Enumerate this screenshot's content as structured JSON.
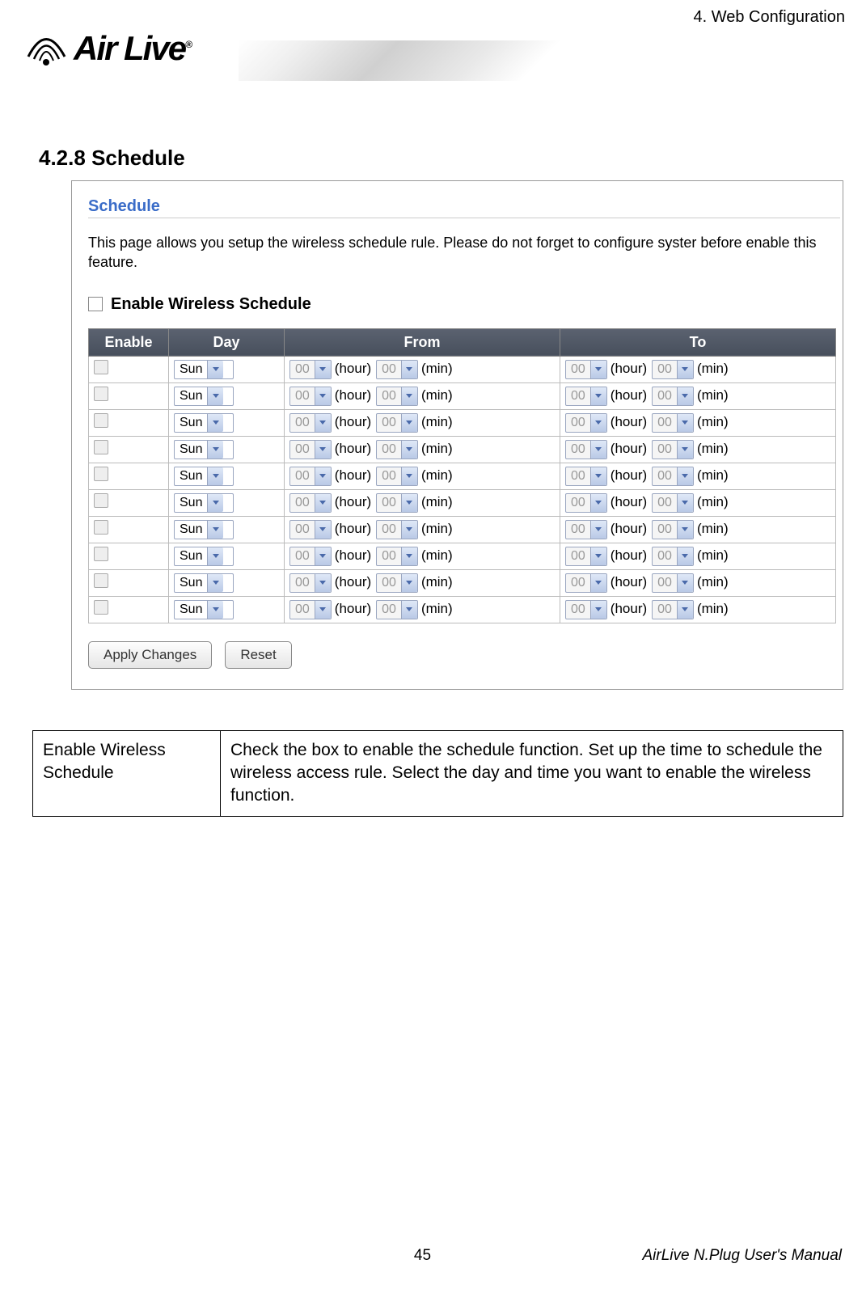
{
  "header": {
    "chapter": "4. Web Configuration",
    "logo_text": "Air Live",
    "logo_reg": "®"
  },
  "section": {
    "number": "4.2.8",
    "title": "Schedule"
  },
  "screenshot": {
    "title": "Schedule",
    "description": "This page allows you setup the wireless schedule rule. Please do not forget to configure syster before enable this feature.",
    "enable_label": "Enable Wireless Schedule",
    "table": {
      "headers": {
        "enable": "Enable",
        "day": "Day",
        "from": "From",
        "to": "To"
      },
      "labels": {
        "hour": "(hour)",
        "min": "(min)"
      },
      "rows": [
        {
          "day": "Sun",
          "from_h": "00",
          "from_m": "00",
          "to_h": "00",
          "to_m": "00"
        },
        {
          "day": "Sun",
          "from_h": "00",
          "from_m": "00",
          "to_h": "00",
          "to_m": "00"
        },
        {
          "day": "Sun",
          "from_h": "00",
          "from_m": "00",
          "to_h": "00",
          "to_m": "00"
        },
        {
          "day": "Sun",
          "from_h": "00",
          "from_m": "00",
          "to_h": "00",
          "to_m": "00"
        },
        {
          "day": "Sun",
          "from_h": "00",
          "from_m": "00",
          "to_h": "00",
          "to_m": "00"
        },
        {
          "day": "Sun",
          "from_h": "00",
          "from_m": "00",
          "to_h": "00",
          "to_m": "00"
        },
        {
          "day": "Sun",
          "from_h": "00",
          "from_m": "00",
          "to_h": "00",
          "to_m": "00"
        },
        {
          "day": "Sun",
          "from_h": "00",
          "from_m": "00",
          "to_h": "00",
          "to_m": "00"
        },
        {
          "day": "Sun",
          "from_h": "00",
          "from_m": "00",
          "to_h": "00",
          "to_m": "00"
        },
        {
          "day": "Sun",
          "from_h": "00",
          "from_m": "00",
          "to_h": "00",
          "to_m": "00"
        }
      ]
    },
    "buttons": {
      "apply": "Apply Changes",
      "reset": "Reset"
    }
  },
  "description_table": {
    "label": "Enable Wireless Schedule",
    "text": "Check the box to enable the schedule function. Set up the time to schedule the wireless access rule. Select the day and time you want to enable the wireless function."
  },
  "footer": {
    "page_number": "45",
    "manual": "AirLive N.Plug User's Manual"
  }
}
